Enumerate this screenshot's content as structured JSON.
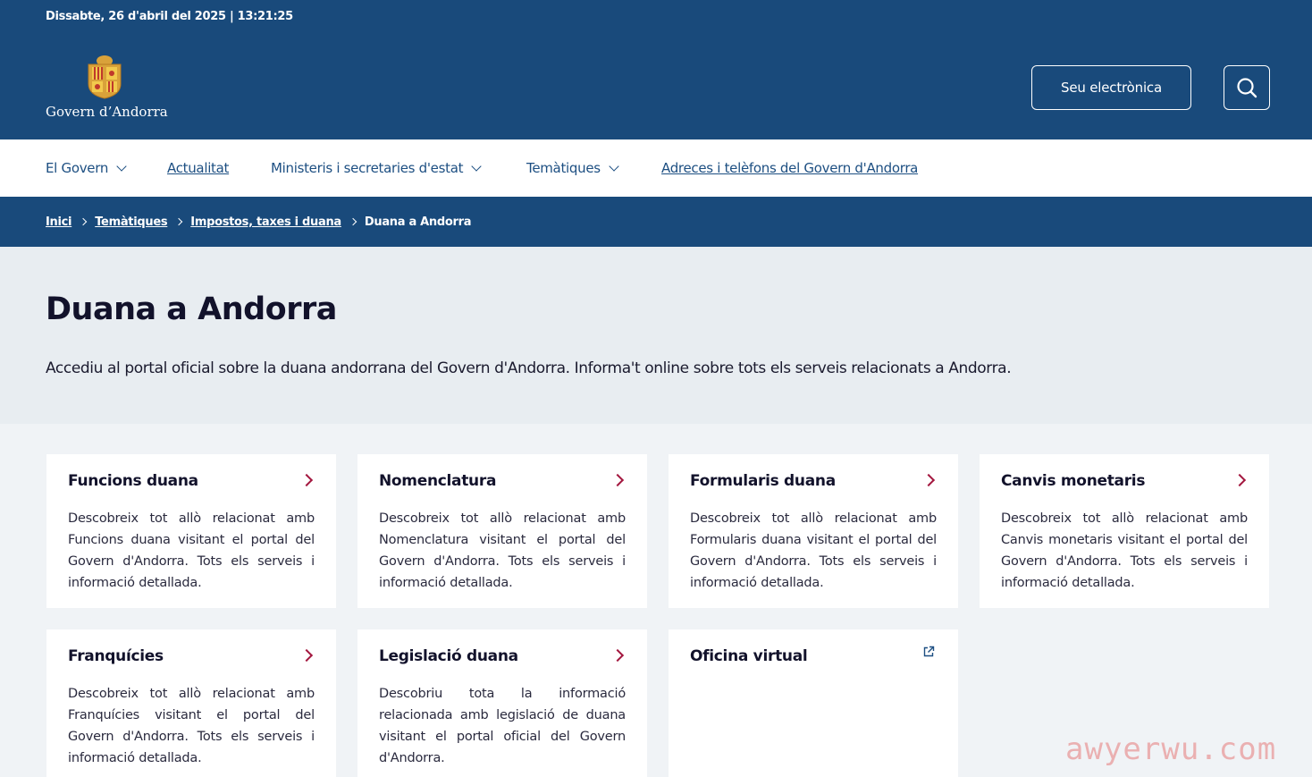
{
  "header": {
    "datetime": "Dissabte, 26 d'abril del 2025 | 13:21:25",
    "logo_text": "Govern d’Andorra",
    "seu_button": "Seu electrònica",
    "search_icon": "search-icon"
  },
  "nav": {
    "items": [
      {
        "label": "El Govern",
        "dropdown": true
      },
      {
        "label": "Actualitat",
        "dropdown": false
      },
      {
        "label": "Ministeris i secretaries d'estat",
        "dropdown": true
      },
      {
        "label": "Temàtiques",
        "dropdown": true
      },
      {
        "label": "Adreces i telèfons del Govern d'Andorra",
        "dropdown": false
      }
    ]
  },
  "breadcrumb": {
    "items": [
      "Inici",
      "Temàtiques",
      "Impostos, taxes i duana",
      "Duana a Andorra"
    ]
  },
  "hero": {
    "title": "Duana a Andorra",
    "description": "Accediu al portal oficial sobre la duana andorrana del Govern d'Andorra. Informa't online sobre tots els serveis relacionats a Andorra."
  },
  "cards": [
    {
      "title": "Funcions duana",
      "icon": "chevron-right-icon",
      "description": "Descobreix tot allò relacionat amb Funcions duana visitant el portal del Govern d'Andorra. Tots els serveis i informació detallada."
    },
    {
      "title": "Nomenclatura",
      "icon": "chevron-right-icon",
      "description": "Descobreix tot allò relacionat amb Nomenclatura visitant el portal del Govern d'Andorra. Tots els serveis i informació detallada."
    },
    {
      "title": "Formularis duana",
      "icon": "chevron-right-icon",
      "description": "Descobreix tot allò relacionat amb Formularis duana visitant el portal del Govern d'Andorra. Tots els serveis i informació detallada."
    },
    {
      "title": "Canvis monetaris",
      "icon": "chevron-right-icon",
      "description": "Descobreix tot allò relacionat amb Canvis monetaris visitant el portal del Govern d'Andorra. Tots els serveis i informació detallada."
    },
    {
      "title": "Franquícies",
      "icon": "chevron-right-icon",
      "description": "Descobreix tot allò relacionat amb Franquícies visitant el portal del Govern d'Andorra. Tots els serveis i informació detallada."
    },
    {
      "title": "Legislació duana",
      "icon": "chevron-right-icon",
      "description": "Descobriu tota la informació relacionada amb legislació de duana visitant el portal oficial del Govern d'Andorra."
    },
    {
      "title": "Oficina virtual",
      "icon": "external-link-icon",
      "description": ""
    }
  ],
  "watermark": "awyerwu.com",
  "colors": {
    "primary": "#194a7b",
    "accent": "#a3173f",
    "hero_bg": "#e8edf1"
  }
}
